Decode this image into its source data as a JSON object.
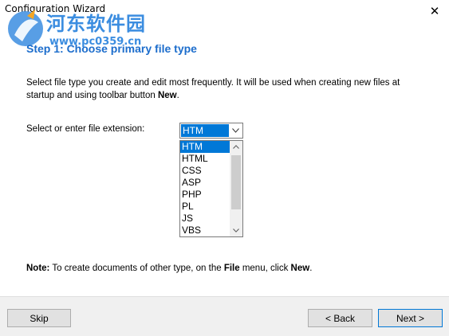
{
  "window": {
    "title": "Configuration Wizard",
    "close_glyph": "✕"
  },
  "watermark": {
    "line1": "河东软件园",
    "line2": "www.pc0359.cn"
  },
  "step": {
    "title": "Step 1: Choose primary file type"
  },
  "description": {
    "text_part1": "Select file type you create and edit most frequently. It will be used when creating new files at startup and using toolbar button ",
    "bold_word": "New",
    "text_part2": "."
  },
  "extension": {
    "label": "Select or enter file extension:",
    "value": "HTM",
    "options": [
      "HTM",
      "HTML",
      "CSS",
      "ASP",
      "PHP",
      "PL",
      "JS",
      "VBS"
    ],
    "selected_index": 0
  },
  "note": {
    "label": "Note:",
    "text1": " To create documents of other type, on the ",
    "file_word": "File",
    "text2": " menu, click ",
    "new_word": "New",
    "text3": "."
  },
  "buttons": {
    "skip": "Skip",
    "back": "< Back",
    "next": "Next >"
  },
  "colors": {
    "accent": "#1c6dcc",
    "selection": "#0078d7",
    "footer_bg": "#f0f0f0"
  }
}
